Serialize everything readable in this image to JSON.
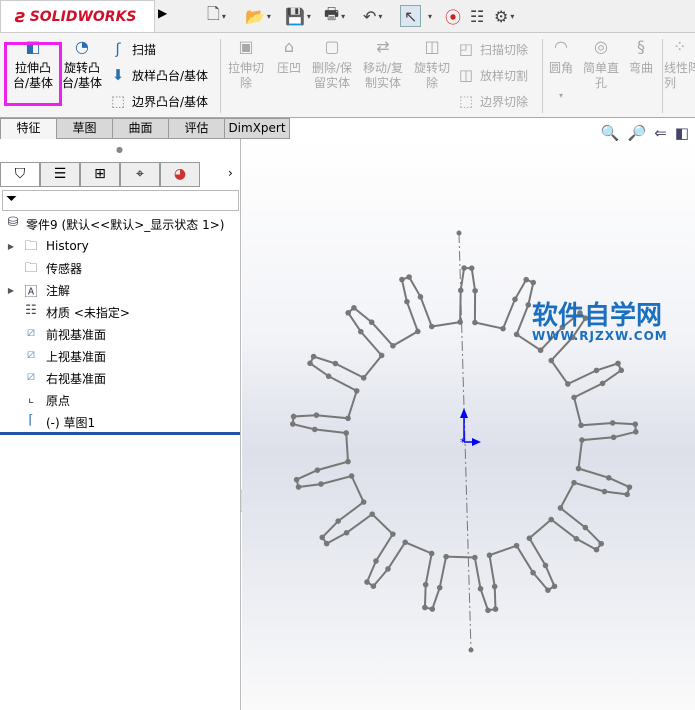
{
  "app": {
    "brand": "SOLIDWORKS"
  },
  "toolbar": {
    "icons": [
      "new-file-icon",
      "open-icon",
      "save-icon",
      "print-icon",
      "undo-icon",
      "select-icon",
      "traffic-light-icon",
      "file-properties-icon",
      "options-gear-icon"
    ]
  },
  "ribbon": {
    "extrude_boss": "拉伸凸\n台/基体",
    "revolve_boss": "旋转凸\n台/基体",
    "sweep": "扫描",
    "loft_boss": "放样凸台/基体",
    "boundary_boss": "边界凸台/基体",
    "extrude_cut": "拉伸切\n除",
    "indent": "压凹",
    "delete_body": "删除/保\n留实体",
    "move_copy": "移动/复\n制实体",
    "revolve_cut": "旋转切\n除",
    "sweep_cut": "扫描切除",
    "loft_cut": "放样切割",
    "boundary_cut": "边界切除",
    "fillet": "圆角",
    "hole": "简单直\n孔",
    "flex": "弯曲",
    "linear_pattern": "线性阵\n列"
  },
  "tabs": [
    "特征",
    "草图",
    "曲面",
    "评估",
    "DimXpert"
  ],
  "active_tab": "特征",
  "tree": {
    "root": "零件9  (默认<<默认>_显示状态 1>)",
    "items": [
      "History",
      "传感器",
      "注解",
      "材质 <未指定>",
      "前视基准面",
      "上视基准面",
      "右视基准面",
      "原点",
      "(-) 草图1"
    ]
  },
  "watermark": {
    "title": "软件自学网",
    "url": "WWW.RJZXW.COM"
  },
  "colors": {
    "highlight": "#ee22ee",
    "brand": "#d0102a",
    "origin": "#0000ff",
    "watermark": "#1a6fc0"
  }
}
